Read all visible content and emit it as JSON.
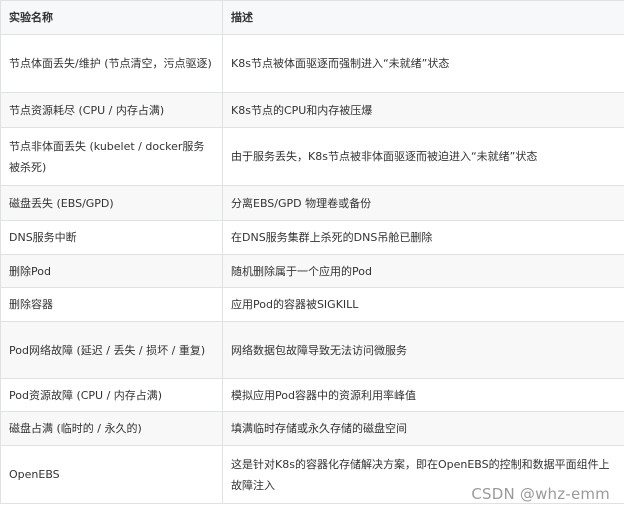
{
  "table": {
    "headers": [
      "实验名称",
      "描述"
    ],
    "rows": [
      [
        "节点体面丢失/维护 (节点清空，污点驱逐)",
        "K8s节点被体面驱逐而强制进入“未就绪”状态"
      ],
      [
        "节点资源耗尽 (CPU / 内存占满)",
        "K8s节点的CPU和内存被压爆"
      ],
      [
        "节点非体面丢失 (kubelet / docker服务被杀死)",
        "由于服务丢失，K8s节点被非体面驱逐而被迫进入“未就绪”状态"
      ],
      [
        "磁盘丢失 (EBS/GPD)",
        "分离EBS/GPD 物理卷或备份"
      ],
      [
        "DNS服务中断",
        "在DNS服务集群上杀死的DNS吊舱已删除"
      ],
      [
        "删除Pod",
        "随机删除属于一个应用的Pod"
      ],
      [
        "删除容器",
        "应用Pod的容器被SIGKILL"
      ],
      [
        "Pod网络故障 (延迟 / 丢失 / 损坏 / 重复)",
        "网络数据包故障导致无法访问微服务"
      ],
      [
        "Pod资源故障 (CPU / 内存占满)",
        "模拟应用Pod容器中的资源利用率峰值"
      ],
      [
        "磁盘占满 (临时的 / 永久的)",
        "填满临时存储或永久存储的磁盘空间"
      ],
      [
        "OpenEBS",
        "这是针对K8s的容器化存储解决方案，即在OpenEBS的控制和数据平面组件上故障注入"
      ]
    ]
  },
  "watermark": "CSDN @whz-emm"
}
